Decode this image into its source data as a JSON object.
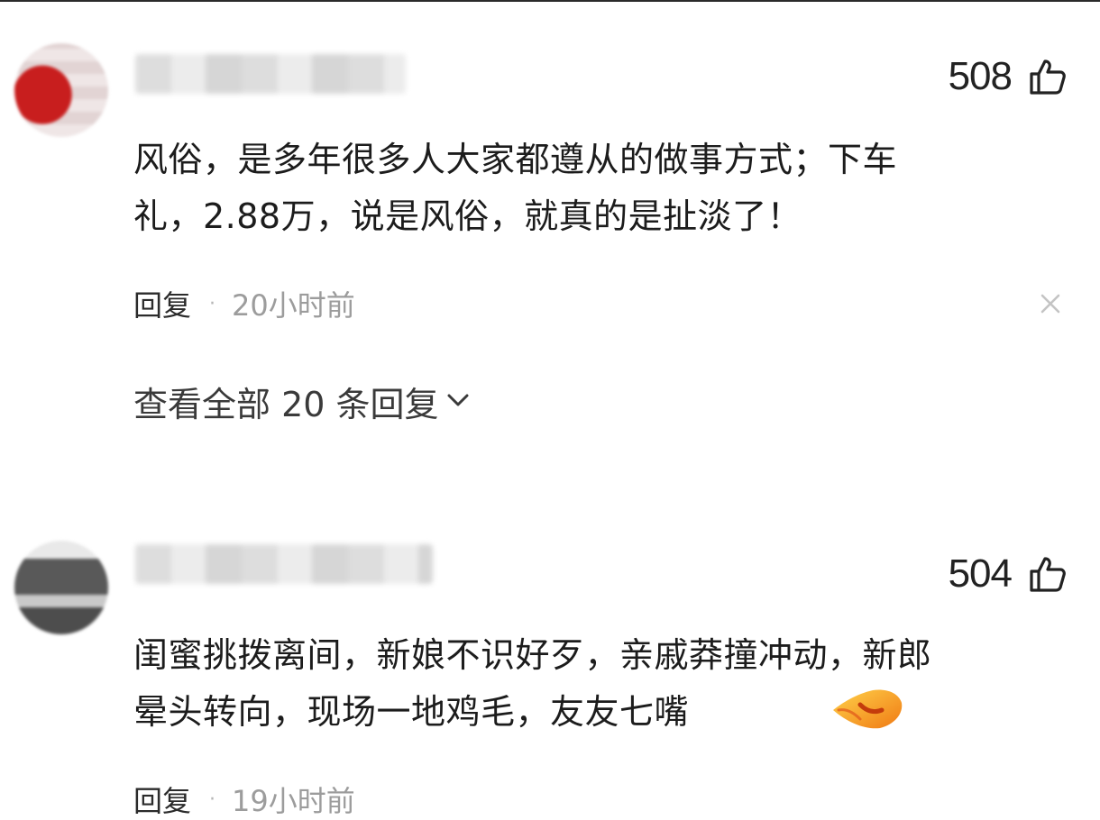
{
  "comments": [
    {
      "likes": "508",
      "text_line1": "风俗，是多年很多人大家都遵从的做事方式；下车",
      "text_line2": "礼，2.88万，说是风俗，就真的是扯淡了！",
      "reply_label": "回复",
      "separator": "·",
      "time": "20小时前",
      "view_all_replies": "查看全部 20 条回复",
      "icons": [
        "thumbs-up-icon",
        "close-icon",
        "chevron-down-icon"
      ]
    },
    {
      "likes": "504",
      "text_line1": "闺蜜挑拨离间，新娘不识好歹，亲戚莽撞冲动，新郎",
      "text_line2": "晕头转向，现场一地鸡毛，友友七嘴",
      "reply_label": "回复",
      "separator": "·",
      "time": "19小时前",
      "icons": [
        "thumbs-up-icon",
        "emoji-icon"
      ]
    }
  ],
  "colors": {
    "text": "#1c1c1c",
    "meta_time": "#9c9c9c",
    "emoji_orange": "#f08a1c"
  }
}
